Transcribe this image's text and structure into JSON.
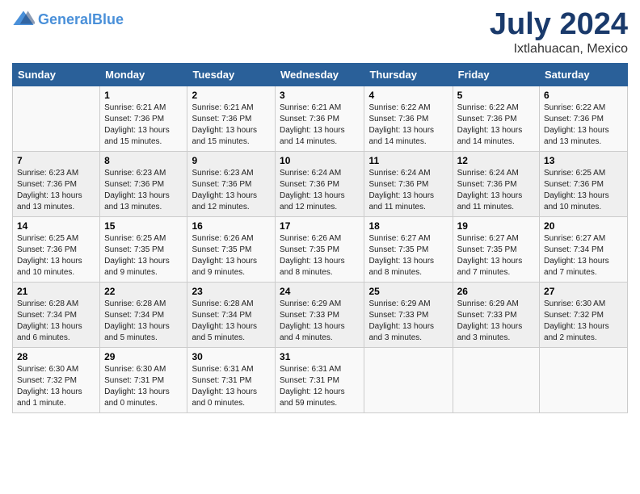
{
  "header": {
    "logo_general": "General",
    "logo_blue": "Blue",
    "title": "July 2024",
    "subtitle": "Ixtlahuacan, Mexico"
  },
  "days_of_week": [
    "Sunday",
    "Monday",
    "Tuesday",
    "Wednesday",
    "Thursday",
    "Friday",
    "Saturday"
  ],
  "weeks": [
    [
      {
        "day": "",
        "info": ""
      },
      {
        "day": "1",
        "info": "Sunrise: 6:21 AM\nSunset: 7:36 PM\nDaylight: 13 hours\nand 15 minutes."
      },
      {
        "day": "2",
        "info": "Sunrise: 6:21 AM\nSunset: 7:36 PM\nDaylight: 13 hours\nand 15 minutes."
      },
      {
        "day": "3",
        "info": "Sunrise: 6:21 AM\nSunset: 7:36 PM\nDaylight: 13 hours\nand 14 minutes."
      },
      {
        "day": "4",
        "info": "Sunrise: 6:22 AM\nSunset: 7:36 PM\nDaylight: 13 hours\nand 14 minutes."
      },
      {
        "day": "5",
        "info": "Sunrise: 6:22 AM\nSunset: 7:36 PM\nDaylight: 13 hours\nand 14 minutes."
      },
      {
        "day": "6",
        "info": "Sunrise: 6:22 AM\nSunset: 7:36 PM\nDaylight: 13 hours\nand 13 minutes."
      }
    ],
    [
      {
        "day": "7",
        "info": "Sunrise: 6:23 AM\nSunset: 7:36 PM\nDaylight: 13 hours\nand 13 minutes."
      },
      {
        "day": "8",
        "info": "Sunrise: 6:23 AM\nSunset: 7:36 PM\nDaylight: 13 hours\nand 13 minutes."
      },
      {
        "day": "9",
        "info": "Sunrise: 6:23 AM\nSunset: 7:36 PM\nDaylight: 13 hours\nand 12 minutes."
      },
      {
        "day": "10",
        "info": "Sunrise: 6:24 AM\nSunset: 7:36 PM\nDaylight: 13 hours\nand 12 minutes."
      },
      {
        "day": "11",
        "info": "Sunrise: 6:24 AM\nSunset: 7:36 PM\nDaylight: 13 hours\nand 11 minutes."
      },
      {
        "day": "12",
        "info": "Sunrise: 6:24 AM\nSunset: 7:36 PM\nDaylight: 13 hours\nand 11 minutes."
      },
      {
        "day": "13",
        "info": "Sunrise: 6:25 AM\nSunset: 7:36 PM\nDaylight: 13 hours\nand 10 minutes."
      }
    ],
    [
      {
        "day": "14",
        "info": "Sunrise: 6:25 AM\nSunset: 7:36 PM\nDaylight: 13 hours\nand 10 minutes."
      },
      {
        "day": "15",
        "info": "Sunrise: 6:25 AM\nSunset: 7:35 PM\nDaylight: 13 hours\nand 9 minutes."
      },
      {
        "day": "16",
        "info": "Sunrise: 6:26 AM\nSunset: 7:35 PM\nDaylight: 13 hours\nand 9 minutes."
      },
      {
        "day": "17",
        "info": "Sunrise: 6:26 AM\nSunset: 7:35 PM\nDaylight: 13 hours\nand 8 minutes."
      },
      {
        "day": "18",
        "info": "Sunrise: 6:27 AM\nSunset: 7:35 PM\nDaylight: 13 hours\nand 8 minutes."
      },
      {
        "day": "19",
        "info": "Sunrise: 6:27 AM\nSunset: 7:35 PM\nDaylight: 13 hours\nand 7 minutes."
      },
      {
        "day": "20",
        "info": "Sunrise: 6:27 AM\nSunset: 7:34 PM\nDaylight: 13 hours\nand 7 minutes."
      }
    ],
    [
      {
        "day": "21",
        "info": "Sunrise: 6:28 AM\nSunset: 7:34 PM\nDaylight: 13 hours\nand 6 minutes."
      },
      {
        "day": "22",
        "info": "Sunrise: 6:28 AM\nSunset: 7:34 PM\nDaylight: 13 hours\nand 5 minutes."
      },
      {
        "day": "23",
        "info": "Sunrise: 6:28 AM\nSunset: 7:34 PM\nDaylight: 13 hours\nand 5 minutes."
      },
      {
        "day": "24",
        "info": "Sunrise: 6:29 AM\nSunset: 7:33 PM\nDaylight: 13 hours\nand 4 minutes."
      },
      {
        "day": "25",
        "info": "Sunrise: 6:29 AM\nSunset: 7:33 PM\nDaylight: 13 hours\nand 3 minutes."
      },
      {
        "day": "26",
        "info": "Sunrise: 6:29 AM\nSunset: 7:33 PM\nDaylight: 13 hours\nand 3 minutes."
      },
      {
        "day": "27",
        "info": "Sunrise: 6:30 AM\nSunset: 7:32 PM\nDaylight: 13 hours\nand 2 minutes."
      }
    ],
    [
      {
        "day": "28",
        "info": "Sunrise: 6:30 AM\nSunset: 7:32 PM\nDaylight: 13 hours\nand 1 minute."
      },
      {
        "day": "29",
        "info": "Sunrise: 6:30 AM\nSunset: 7:31 PM\nDaylight: 13 hours\nand 0 minutes."
      },
      {
        "day": "30",
        "info": "Sunrise: 6:31 AM\nSunset: 7:31 PM\nDaylight: 13 hours\nand 0 minutes."
      },
      {
        "day": "31",
        "info": "Sunrise: 6:31 AM\nSunset: 7:31 PM\nDaylight: 12 hours\nand 59 minutes."
      },
      {
        "day": "",
        "info": ""
      },
      {
        "day": "",
        "info": ""
      },
      {
        "day": "",
        "info": ""
      }
    ]
  ]
}
